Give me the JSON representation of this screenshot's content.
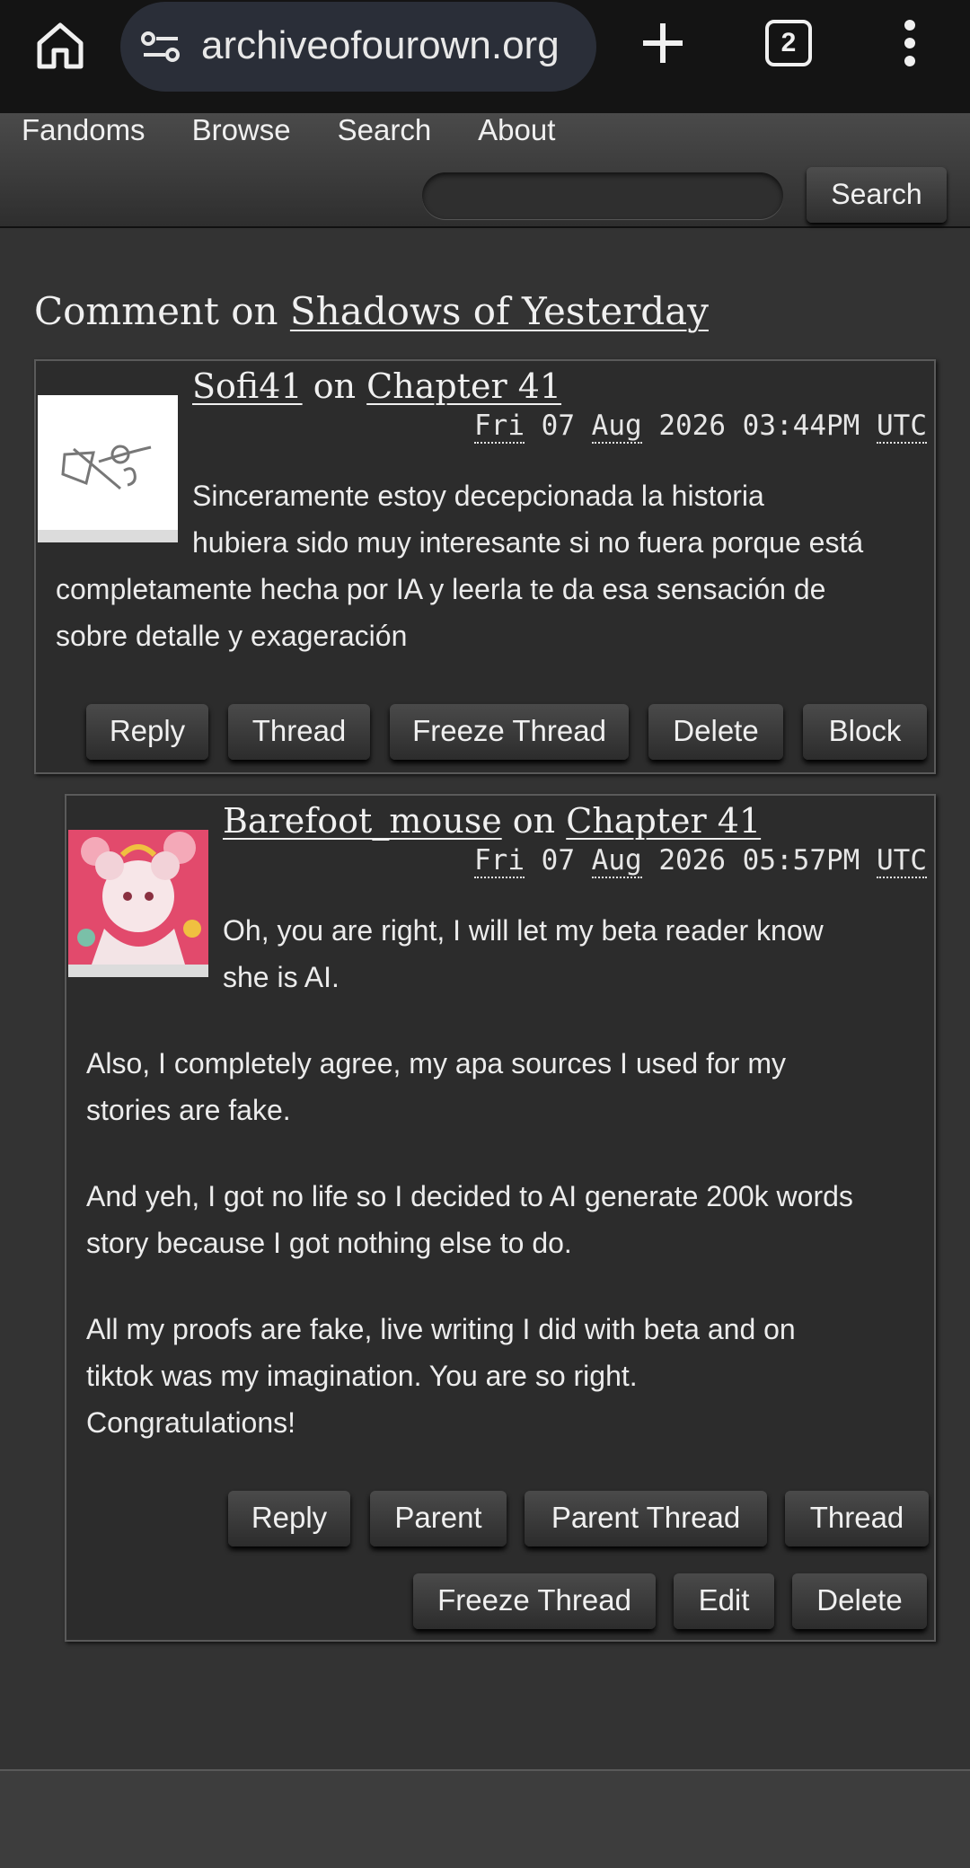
{
  "browser": {
    "url": "archiveofourown.org",
    "tab_count": "2"
  },
  "site_nav": {
    "items": [
      "Fandoms",
      "Browse",
      "Search",
      "About"
    ],
    "search_button": "Search"
  },
  "page": {
    "title_prefix": "Comment on",
    "work_title": "Shadows of Yesterday"
  },
  "comments": [
    {
      "author": "Sofi41",
      "on": "on",
      "chapter": "Chapter 41",
      "date": {
        "day": "Fri",
        "date_num": "07",
        "month": "Aug",
        "year": "2026",
        "time": "03:44PM",
        "tz": "UTC"
      },
      "body_line1": "Sinceramente estoy decepcionada la historia",
      "body_line2": "hubiera sido muy interesante si no fuera porque está",
      "body_line3": "completamente hecha por IA y leerla te da esa sensación de",
      "body_line4": "sobre detalle y exageración",
      "actions": [
        "Reply",
        "Thread",
        "Freeze Thread",
        "Delete",
        "Block"
      ]
    },
    {
      "author": "Barefoot_mouse",
      "on": "on",
      "chapter": "Chapter 41",
      "date": {
        "day": "Fri",
        "date_num": "07",
        "month": "Aug",
        "year": "2026",
        "time": "05:57PM",
        "tz": "UTC"
      },
      "p1_line1": "Oh, you are right, I will let my beta reader know",
      "p1_line2": "she is AI.",
      "p2_line1": "Also, I completely agree, my apa sources I used for my",
      "p2_line2": "stories are fake.",
      "p3_line1": "And yeh, I got no life so I decided to AI generate 200k words",
      "p3_line2": "story because I got nothing else to do.",
      "p4_line1": "All my proofs are fake, live writing I did with beta and on",
      "p4_line2": "tiktok was my imagination. You are so right.",
      "p4_line3": "Congratulations!",
      "actions_row1": [
        "Reply",
        "Parent",
        "Parent Thread",
        "Thread"
      ],
      "actions_row2": [
        "Freeze Thread",
        "Edit",
        "Delete"
      ]
    }
  ]
}
